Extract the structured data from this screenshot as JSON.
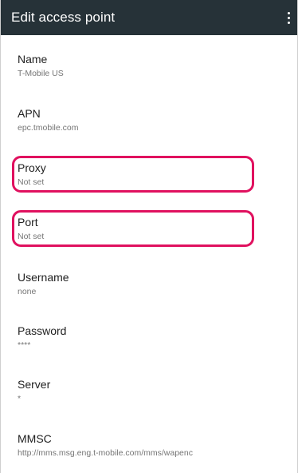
{
  "app_bar": {
    "title": "Edit access point",
    "overflow_icon": "more-vert-icon"
  },
  "preferences": [
    {
      "key": "name",
      "title": "Name",
      "summary": "T-Mobile US"
    },
    {
      "key": "apn",
      "title": "APN",
      "summary": "epc.tmobile.com"
    },
    {
      "key": "proxy",
      "title": "Proxy",
      "summary": "Not set"
    },
    {
      "key": "port",
      "title": "Port",
      "summary": "Not set"
    },
    {
      "key": "username",
      "title": "Username",
      "summary": "none"
    },
    {
      "key": "password",
      "title": "Password",
      "summary": "****"
    },
    {
      "key": "server",
      "title": "Server",
      "summary": "*"
    },
    {
      "key": "mmsc",
      "title": "MMSC",
      "summary": "http://mms.msg.eng.t-mobile.com/mms/wapenc"
    }
  ],
  "colors": {
    "app_bar": "#263238",
    "highlight": "#e0115f",
    "title_text": "#212121",
    "summary_text": "#757575"
  }
}
